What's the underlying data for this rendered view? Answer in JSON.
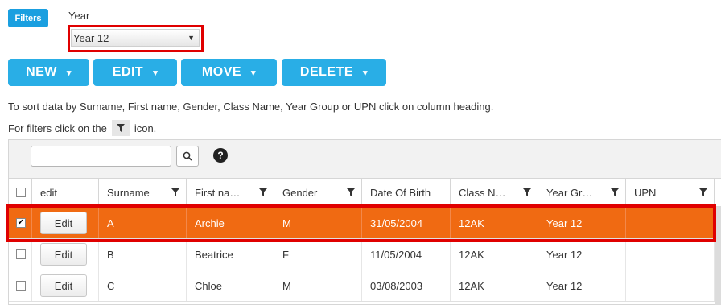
{
  "filters": {
    "badge_label": "Filters",
    "year_label": "Year",
    "year_value": "Year 12"
  },
  "actions": {
    "new_label": "NEW",
    "edit_label": "EDIT",
    "move_label": "MOVE",
    "delete_label": "DELETE",
    "caret": "▾"
  },
  "info": {
    "sort_text": "To sort data by Surname, First name, Gender, Class Name, Year Group or UPN click on column heading.",
    "filter_prefix": "For filters click on the",
    "filter_suffix": "icon."
  },
  "toolbar": {
    "search_value": "",
    "help": "?"
  },
  "columns": [
    "edit",
    "Surname",
    "First na…",
    "Gender",
    "Date Of Birth",
    "Class N…",
    "Year Gr…",
    "UPN"
  ],
  "rows": [
    {
      "checked": "✔",
      "edit": "Edit",
      "surname": "A",
      "first_name": "Archie",
      "gender": "M",
      "dob": "31/05/2004",
      "class": "12AK",
      "year": "Year 12",
      "upn": ""
    },
    {
      "checked": "",
      "edit": "Edit",
      "surname": "B",
      "first_name": "Beatrice",
      "gender": "F",
      "dob": "11/05/2004",
      "class": "12AK",
      "year": "Year 12",
      "upn": ""
    },
    {
      "checked": "",
      "edit": "Edit",
      "surname": "C",
      "first_name": "Chloe",
      "gender": "M",
      "dob": "03/08/2003",
      "class": "12AK",
      "year": "Year 12",
      "upn": ""
    }
  ],
  "colors": {
    "accent": "#29aee6",
    "selected_row": "#f06a12",
    "highlight": "#e00000"
  }
}
